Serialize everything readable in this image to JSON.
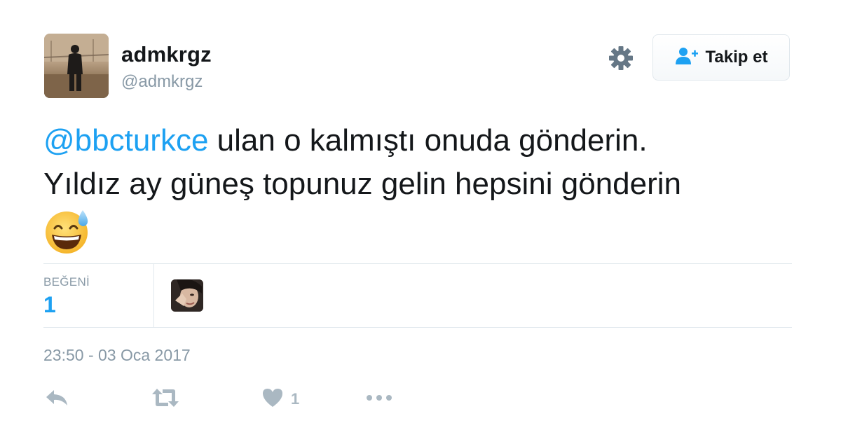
{
  "user": {
    "display_name": "admkrgz",
    "handle": "@admkrgz"
  },
  "header": {
    "settings_icon": "gear-icon",
    "follow_icon": "person-add-icon",
    "follow_label": "Takip et"
  },
  "tweet": {
    "mention": "@bbcturkce",
    "text_line1": " ulan o kalmıştı onuda gönderin.",
    "text_line2": "Yıldız ay güneş topunuz gelin hepsini gönderin",
    "emoji": "smiling-face-with-open-mouth-and-cold-sweat"
  },
  "stats": {
    "likes_label": "BEĞENİ",
    "likes_count": "1"
  },
  "timestamp": "23:50 - 03 Oca 2017",
  "actions": {
    "reply_icon": "reply-icon",
    "retweet_icon": "retweet-icon",
    "like_icon": "heart-icon",
    "like_count": "1",
    "more_icon": "more-icon"
  },
  "colors": {
    "accent": "#1da1f2",
    "muted": "#8899a6",
    "icon_gray": "#aab8c2",
    "border": "#e1e8ed",
    "text": "#14171a"
  }
}
